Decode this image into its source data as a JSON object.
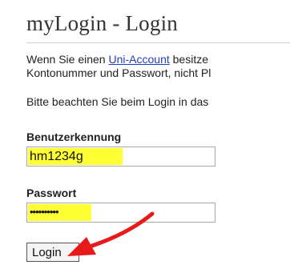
{
  "page": {
    "title": "myLogin - Login"
  },
  "intro": {
    "text_before_link": "Wenn Sie einen ",
    "link_text": "Uni-Account",
    "text_after_link": " besitze",
    "line2": "Kontonummer und Passwort, nicht Pl"
  },
  "notice": {
    "text": "Bitte beachten Sie beim Login in das"
  },
  "form": {
    "username_label": "Benutzerkennung",
    "username_value": "hm1234g",
    "password_label": "Passwort",
    "password_value": "••••••••••",
    "login_button": "Login"
  },
  "colors": {
    "highlight": "#ffff33",
    "arrow": "#e8191b",
    "link": "#1f3fbf"
  }
}
